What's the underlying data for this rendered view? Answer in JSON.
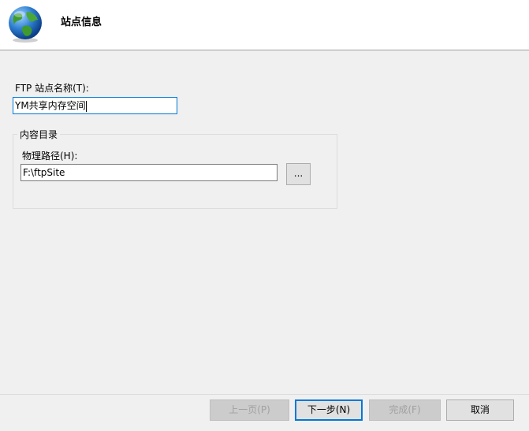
{
  "header": {
    "title": "站点信息",
    "icon": "globe-icon"
  },
  "site_name": {
    "label": "FTP 站点名称(T):",
    "value": "YM共享内存空间"
  },
  "content_dir": {
    "group_label": "内容目录",
    "path_label": "物理路径(H):",
    "path_value": "F:\\ftpSite",
    "browse_label": "..."
  },
  "buttons": {
    "prev": "上一页(P)",
    "next": "下一步(N)",
    "finish": "完成(F)",
    "cancel": "取消"
  },
  "colors": {
    "focus_border": "#0078d7",
    "disabled_text": "#a0a0a0"
  }
}
